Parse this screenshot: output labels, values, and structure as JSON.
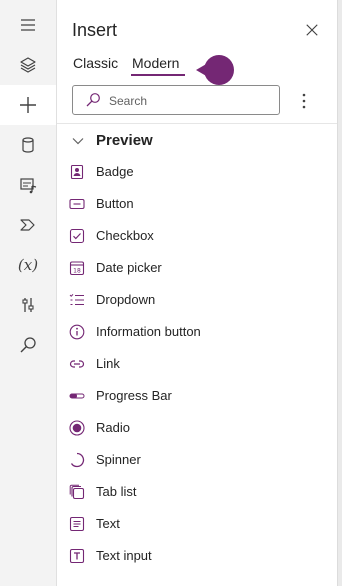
{
  "panel": {
    "title": "Insert",
    "tabs": [
      {
        "label": "Classic",
        "selected": false
      },
      {
        "label": "Modern",
        "selected": true
      }
    ],
    "search": {
      "placeholder": "Search",
      "value": ""
    },
    "section": {
      "title": "Preview",
      "expanded": true
    },
    "items": [
      {
        "label": "Badge",
        "icon": "badge-icon"
      },
      {
        "label": "Button",
        "icon": "button-icon"
      },
      {
        "label": "Checkbox",
        "icon": "checkbox-icon"
      },
      {
        "label": "Date picker",
        "icon": "calendar-icon"
      },
      {
        "label": "Dropdown",
        "icon": "dropdown-list-icon"
      },
      {
        "label": "Information button",
        "icon": "info-icon"
      },
      {
        "label": "Link",
        "icon": "link-icon"
      },
      {
        "label": "Progress Bar",
        "icon": "progress-bar-icon"
      },
      {
        "label": "Radio",
        "icon": "radio-icon"
      },
      {
        "label": "Spinner",
        "icon": "spinner-icon"
      },
      {
        "label": "Tab list",
        "icon": "tab-list-icon"
      },
      {
        "label": "Text",
        "icon": "text-icon"
      },
      {
        "label": "Text input",
        "icon": "text-input-icon"
      }
    ]
  },
  "rail": {
    "items": [
      {
        "icon": "hamburger-menu-icon"
      },
      {
        "icon": "layers-icon"
      },
      {
        "icon": "insert-plus-icon",
        "active": true
      },
      {
        "icon": "database-icon"
      },
      {
        "icon": "media-icon"
      },
      {
        "icon": "power-automate-icon"
      },
      {
        "icon": "variables-icon",
        "text": "(x)"
      },
      {
        "icon": "tools-icon"
      },
      {
        "icon": "search-icon"
      }
    ]
  },
  "colors": {
    "accent": "#742774",
    "icon": "#742774",
    "text": "#242424",
    "rail_bg": "#f3f3f3"
  }
}
